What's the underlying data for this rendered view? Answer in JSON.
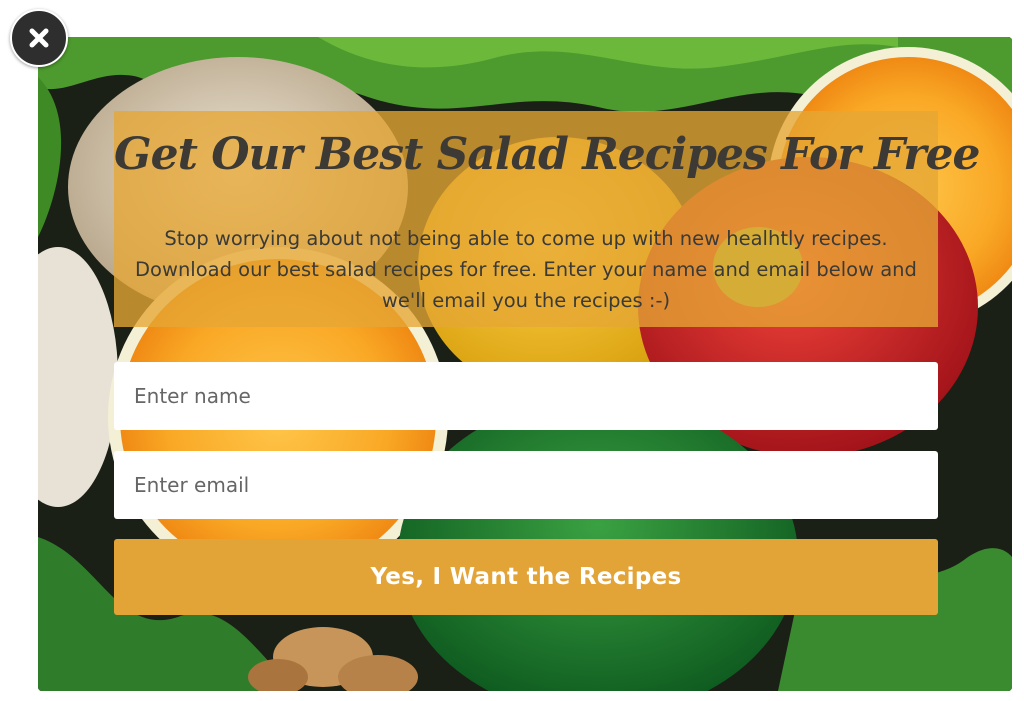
{
  "popup": {
    "close_icon": "close-x-icon",
    "headline": "Get Our Best Salad Recipes For Free",
    "subtext": "Stop worrying about not being able to come up with new healhtly recipes. Download our best salad recipes for free.  Enter your name and email below and we'll email you the recipes :-)",
    "name_placeholder": "Enter name",
    "name_value": "",
    "email_placeholder": "Enter email",
    "email_value": "",
    "submit_label": "Yes, I Want the Recipes"
  },
  "colors": {
    "panel_overlay": "#e6a634",
    "button": "#e3a437",
    "headline_text": "#3d3a36",
    "close_button_bg": "#2e2e2e"
  }
}
